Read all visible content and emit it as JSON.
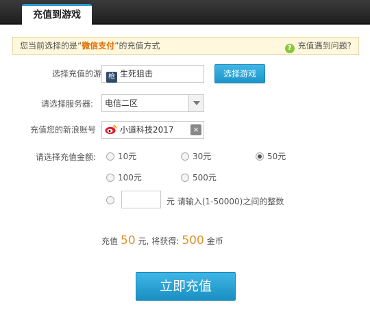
{
  "tab": {
    "label": "充值到游戏"
  },
  "notice": {
    "prefix": "您当前选择的是“",
    "method": "微信支付",
    "suffix": "”的充值方式",
    "help_label": "充值遇到问题?"
  },
  "form": {
    "game": {
      "label": "选择充值的游戏:",
      "value": "生死狙击",
      "icon_text": "枪",
      "button": "选择游戏"
    },
    "server": {
      "label": "请选择服务器:",
      "value": "电信二区"
    },
    "account": {
      "label": "充值您的新浪账号",
      "value": "小道科技2017",
      "clear": "×"
    },
    "amount": {
      "label": "请选择充值金额:",
      "options": [
        {
          "label": "10元",
          "selected": false
        },
        {
          "label": "30元",
          "selected": false
        },
        {
          "label": "50元",
          "selected": true
        },
        {
          "label": "100元",
          "selected": false
        },
        {
          "label": "500元",
          "selected": false
        }
      ],
      "custom_unit": "元",
      "custom_hint": "请输入(1-50000)之间的整数"
    }
  },
  "summary": {
    "prefix": "充值",
    "amount": "50",
    "middle": "元, 将获得:",
    "coins": "500",
    "suffix": "金币"
  },
  "submit": {
    "label": "立即充值"
  }
}
